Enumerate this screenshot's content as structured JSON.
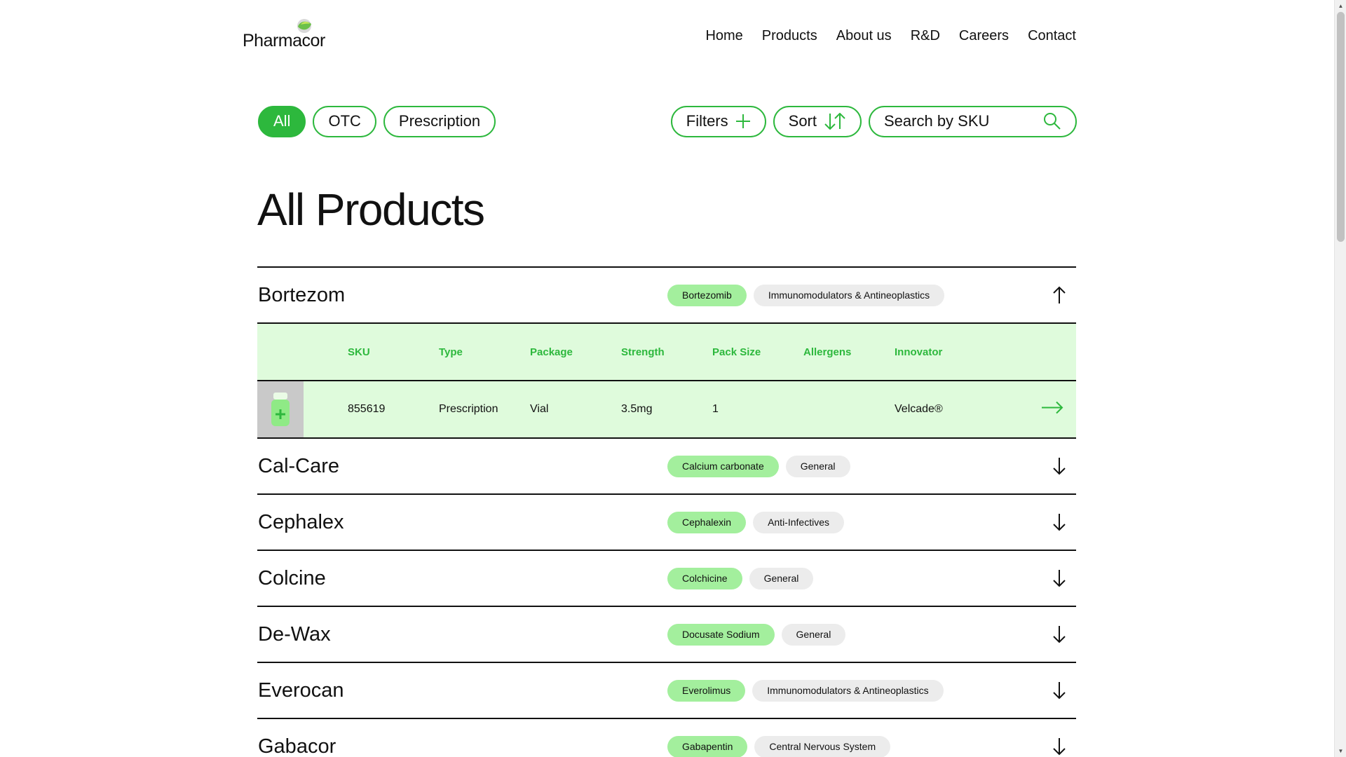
{
  "brand": {
    "name": "Pharmacor"
  },
  "nav": [
    {
      "label": "Home"
    },
    {
      "label": "Products"
    },
    {
      "label": "About us"
    },
    {
      "label": "R&D"
    },
    {
      "label": "Careers"
    },
    {
      "label": "Contact"
    }
  ],
  "category_filters": [
    {
      "label": "All",
      "active": true
    },
    {
      "label": "OTC",
      "active": false
    },
    {
      "label": "Prescription",
      "active": false
    }
  ],
  "tools": {
    "filters_label": "Filters",
    "sort_label": "Sort",
    "search_placeholder": "Search by SKU"
  },
  "page_title": "All Products",
  "colors": {
    "accent": "#2db83d",
    "tag_primary": "#a3ef9d",
    "tag_secondary": "#ececec",
    "detail_bg": "#dffbdc"
  },
  "products": [
    {
      "name": "Bortezom",
      "ingredient": "Bortezomib",
      "category": "Immunomodulators & Antineoplastics",
      "expanded": true,
      "columns": [
        "SKU",
        "Type",
        "Package",
        "Strength",
        "Pack Size",
        "Allergens",
        "Innovator"
      ],
      "sku": {
        "sku": "855619",
        "type": "Prescription",
        "package": "Vial",
        "strength": "3.5mg",
        "pack_size": "1",
        "allergens": "",
        "innovator": "Velcade®"
      }
    },
    {
      "name": "Cal-Care",
      "ingredient": "Calcium carbonate",
      "category": "General",
      "expanded": false
    },
    {
      "name": "Cephalex",
      "ingredient": "Cephalexin",
      "category": "Anti-Infectives",
      "expanded": false
    },
    {
      "name": "Colcine",
      "ingredient": "Colchicine",
      "category": "General",
      "expanded": false
    },
    {
      "name": "De-Wax",
      "ingredient": "Docusate Sodium",
      "category": "General",
      "expanded": false
    },
    {
      "name": "Everocan",
      "ingredient": "Everolimus",
      "category": "Immunomodulators & Antineoplastics",
      "expanded": false
    },
    {
      "name": "Gabacor",
      "ingredient": "Gabapentin",
      "category": "Central Nervous System",
      "expanded": false
    }
  ]
}
